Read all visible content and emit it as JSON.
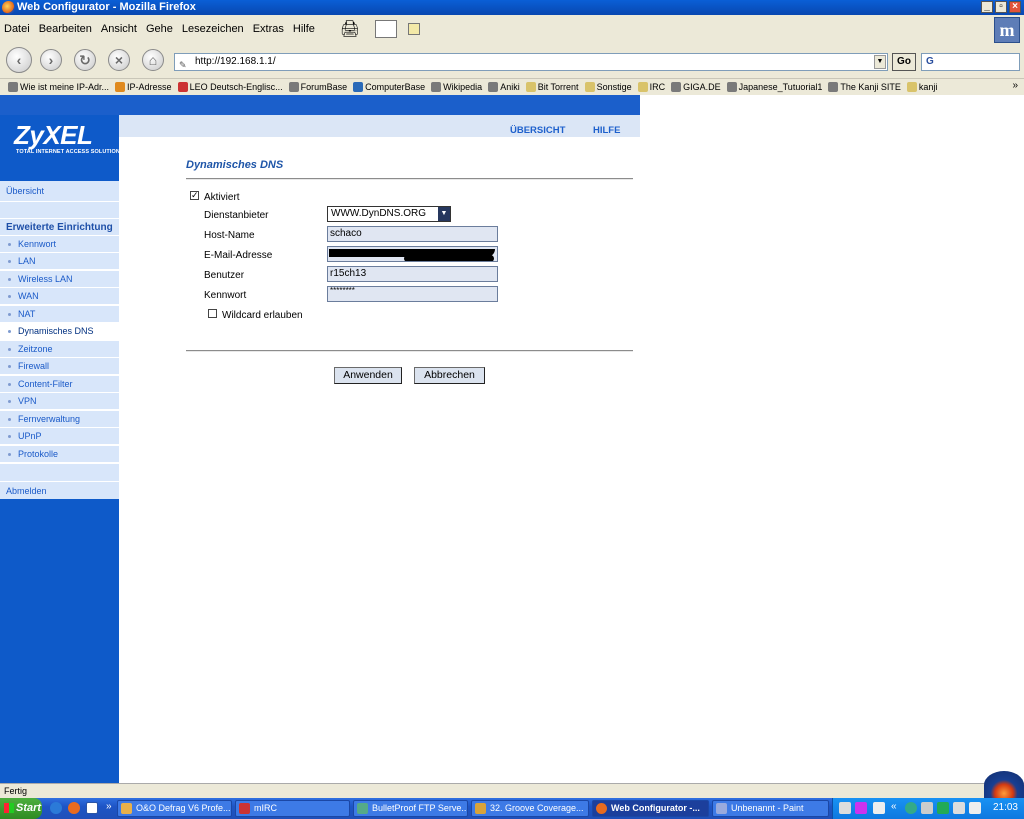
{
  "window": {
    "title": "Web Configurator - Mozilla Firefox"
  },
  "menu": [
    "Datei",
    "Bearbeiten",
    "Ansicht",
    "Gehe",
    "Lesezeichen",
    "Extras",
    "Hilfe"
  ],
  "toolbar": {
    "url": "http://192.168.1.1/",
    "go_label": "Go",
    "search_placeholder": ""
  },
  "bookmarks": [
    {
      "label": "Wie ist meine IP-Adr...",
      "color": "#7a7a7a"
    },
    {
      "label": "IP-Adresse",
      "color": "#e08a1e"
    },
    {
      "label": "LEO Deutsch-Englisc...",
      "color": "#c33"
    },
    {
      "label": "ForumBase",
      "color": "#7a7a7a"
    },
    {
      "label": "ComputerBase",
      "color": "#2a6ab8"
    },
    {
      "label": "Wikipedia",
      "color": "#7a7a7a"
    },
    {
      "label": "Aniki",
      "color": "#7a7a7a"
    },
    {
      "label": "Bit Torrent",
      "color": "#d9c36a"
    },
    {
      "label": "Sonstige",
      "color": "#d9c36a"
    },
    {
      "label": "IRC",
      "color": "#d9c36a"
    },
    {
      "label": "GIGA.DE",
      "color": "#7a7a7a"
    },
    {
      "label": "Japanese_Tutuorial1",
      "color": "#7a7a7a"
    },
    {
      "label": "The Kanji SITE",
      "color": "#7a7a7a"
    },
    {
      "label": "kanji",
      "color": "#d9c36a"
    }
  ],
  "brand": {
    "logo": "ZyXEL",
    "tagline": "TOTAL INTERNET ACCESS SOLUTION"
  },
  "header_links": {
    "overview": "ÜBERSICHT",
    "help": "HILFE"
  },
  "sidebar": {
    "overview": "Übersicht",
    "section": "Erweiterte Einrichtung",
    "items": [
      "Kennwort",
      "LAN",
      "Wireless LAN",
      "WAN",
      "NAT",
      "Dynamisches DNS",
      "Zeitzone",
      "Firewall",
      "Content-Filter",
      "VPN",
      "Fernverwaltung",
      "UPnP",
      "Protokolle"
    ],
    "active": "Dynamisches DNS",
    "logout": "Abmelden"
  },
  "form": {
    "title": "Dynamisches DNS",
    "enabled_label": "Aktiviert",
    "enabled": true,
    "provider_label": "Dienstanbieter",
    "provider_value": "WWW.DynDNS.ORG",
    "host_label": "Host-Name",
    "host_value": "schaco",
    "email_label": "E-Mail-Adresse",
    "email_value": "",
    "user_label": "Benutzer",
    "user_value": "r15ch13",
    "password_label": "Kennwort",
    "password_value": "********",
    "wildcard_label": "Wildcard erlauben",
    "wildcard": false,
    "apply_label": "Anwenden",
    "cancel_label": "Abbrechen"
  },
  "status": {
    "text": "Fertig"
  },
  "taskbar": {
    "start_label": "Start",
    "tasks": [
      "O&O Defrag V6 Profe...",
      "mIRC",
      "BulletProof FTP Serve...",
      "32. Groove Coverage...",
      "Web Configurator -...",
      "Unbenannt - Paint"
    ],
    "active_task": "Web Configurator -...",
    "clock": "21:03"
  }
}
